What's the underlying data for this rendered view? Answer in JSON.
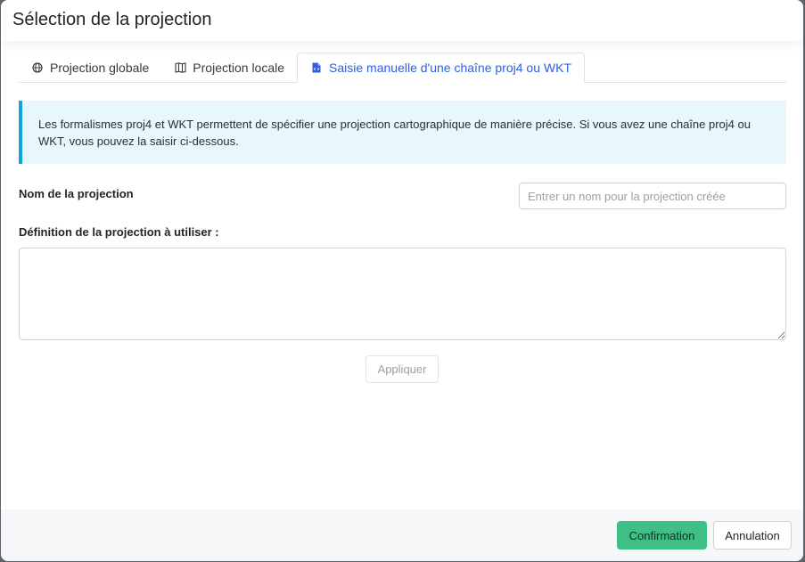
{
  "dialog": {
    "title": "Sélection de la projection"
  },
  "tabs": [
    {
      "label": "Projection globale",
      "icon": "globe-icon",
      "active": false
    },
    {
      "label": "Projection locale",
      "icon": "map-icon",
      "active": false
    },
    {
      "label": "Saisie manuelle d'une chaîne proj4 ou WKT",
      "icon": "file-code-icon",
      "active": true
    }
  ],
  "info": {
    "line1": "Les formalismes proj4 et WKT permettent de spécifier une projection cartographique de manière précise. Si vous avez une chaîne proj4 ou",
    "line2": "WKT, vous pouvez la saisir ci-dessous."
  },
  "form": {
    "name_label": "Nom de la projection",
    "name_value": "",
    "name_placeholder": "Entrer un nom pour la projection créée",
    "definition_label": "Définition de la projection à utiliser :",
    "definition_value": "",
    "apply_label": "Appliquer"
  },
  "footer": {
    "confirm_label": "Confirmation",
    "cancel_label": "Annulation"
  },
  "colors": {
    "accent_tab": "#2f5fe0",
    "info_border": "#0ea5df",
    "info_bg": "#e8f6fd",
    "confirm_bg": "#3dbf86"
  }
}
